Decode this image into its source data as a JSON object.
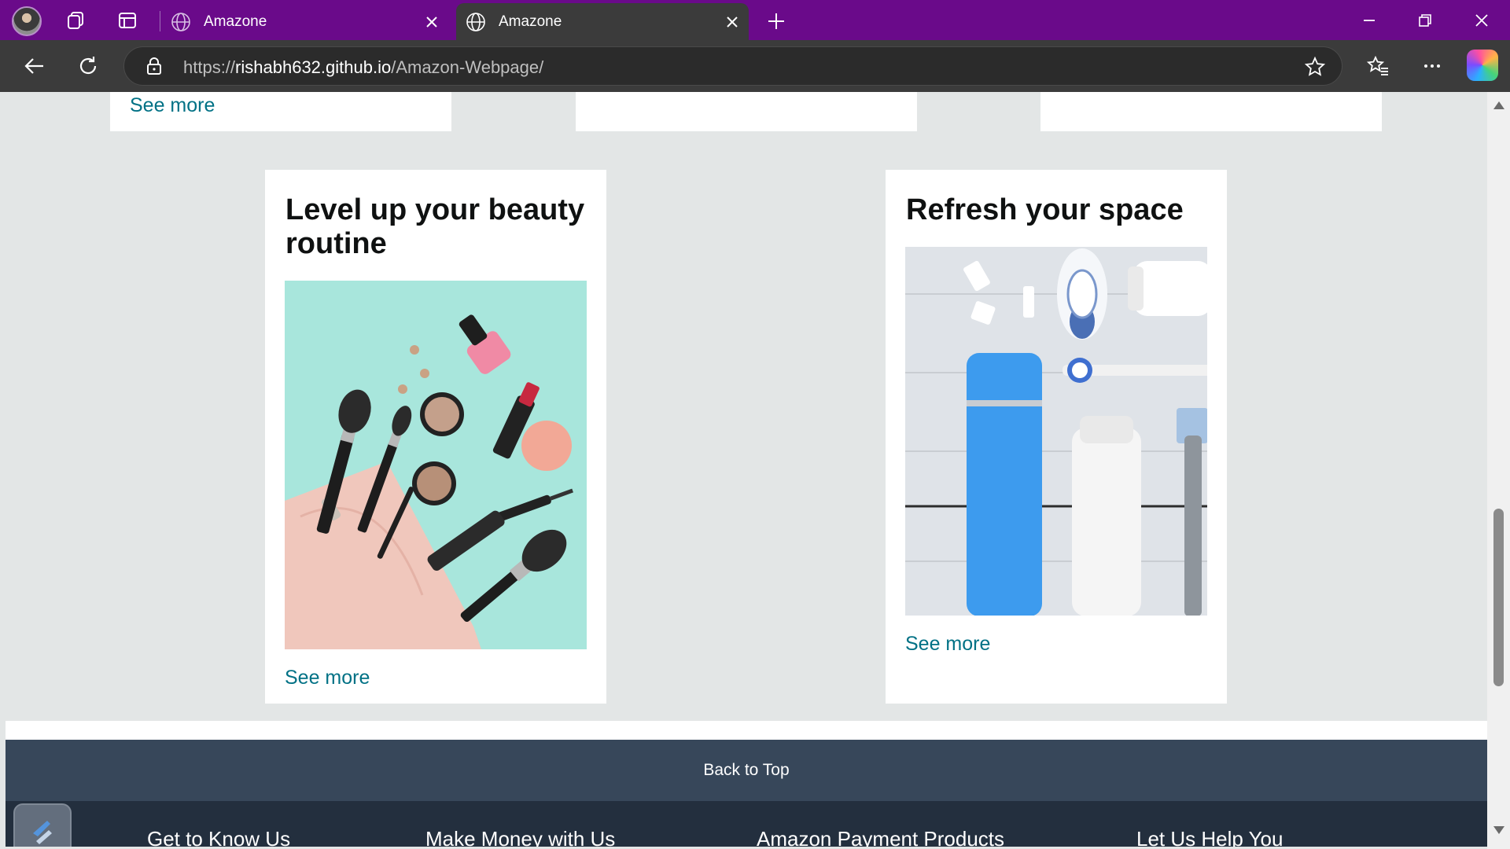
{
  "browser": {
    "tabs": [
      {
        "title": "Amazone",
        "active": false
      },
      {
        "title": "Amazone",
        "active": true
      }
    ],
    "address": {
      "scheme": "https://",
      "host": "rishabh632.github.io",
      "path": "/Amazon-Webpage/"
    },
    "colors": {
      "titlebar": "#6a0a8a",
      "toolbar": "#3b3b3b"
    }
  },
  "page": {
    "top_cards": [
      {
        "link": "See more"
      },
      {
        "link": ""
      },
      {
        "link": ""
      }
    ],
    "cards": [
      {
        "title": "Level up your beauty routine",
        "image": "makeup-products-image",
        "link": "See more"
      },
      {
        "title": "Refresh your space",
        "image": "toiletries-image",
        "link": "See more"
      }
    ],
    "back_to_top": "Back to Top",
    "footer_columns": [
      "Get to Know Us",
      "Make Money with Us",
      "Amazon Payment Products",
      "Let Us Help You"
    ],
    "colors": {
      "link": "#007185",
      "footer_top": "#37475a",
      "footer": "#232f3e"
    }
  }
}
